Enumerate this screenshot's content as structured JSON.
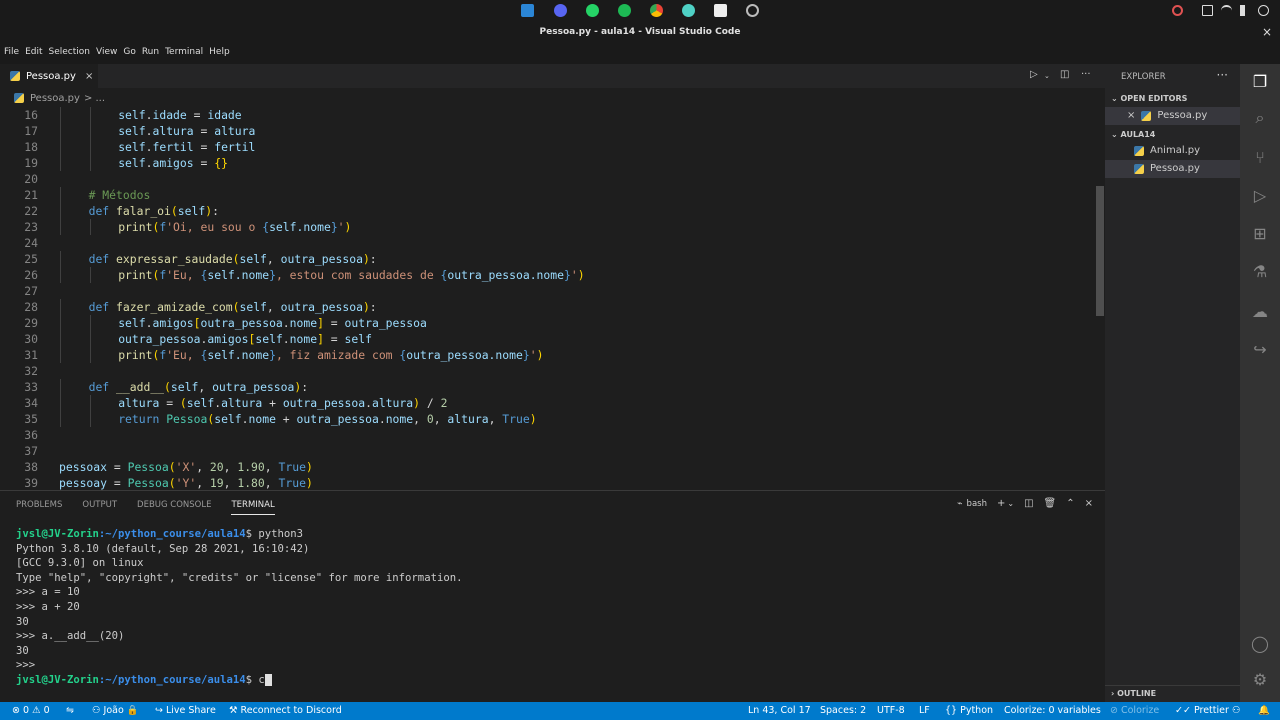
{
  "window": {
    "title": "Pessoa.py - aula14 - Visual Studio Code",
    "close": "×"
  },
  "menu": [
    "File",
    "Edit",
    "Selection",
    "View",
    "Go",
    "Run",
    "Terminal",
    "Help"
  ],
  "tab": {
    "label": "Pessoa.py",
    "close": "×"
  },
  "breadcrumb": {
    "file": "Pessoa.py",
    "more": "> ..."
  },
  "code_lines": [
    {
      "n": "16",
      "text": "self.idade = idade",
      "indent": 2
    },
    {
      "n": "17",
      "text": "self.altura = altura",
      "indent": 2
    },
    {
      "n": "18",
      "text": "self.fertil = fertil",
      "indent": 2
    },
    {
      "n": "19",
      "text": "self.amigos = {}",
      "indent": 2
    },
    {
      "n": "20",
      "text": "",
      "indent": 0
    },
    {
      "n": "21",
      "text": "# Métodos",
      "indent": 1,
      "kind": "comment"
    },
    {
      "n": "22",
      "text": "def falar_oi(self):",
      "indent": 1,
      "kind": "def"
    },
    {
      "n": "23",
      "text": "print(f'Oi, eu sou o {self.nome}')",
      "indent": 2
    },
    {
      "n": "24",
      "text": "",
      "indent": 0
    },
    {
      "n": "25",
      "text": "def expressar_saudade(self, outra_pessoa):",
      "indent": 1,
      "kind": "def"
    },
    {
      "n": "26",
      "text": "print(f'Eu, {self.nome}, estou com saudades de {outra_pessoa.nome}')",
      "indent": 2
    },
    {
      "n": "27",
      "text": "",
      "indent": 0
    },
    {
      "n": "28",
      "text": "def fazer_amizade_com(self, outra_pessoa):",
      "indent": 1,
      "kind": "def"
    },
    {
      "n": "29",
      "text": "self.amigos[outra_pessoa.nome] = outra_pessoa",
      "indent": 2
    },
    {
      "n": "30",
      "text": "outra_pessoa.amigos[self.nome] = self",
      "indent": 2
    },
    {
      "n": "31",
      "text": "print(f'Eu, {self.nome}, fiz amizade com {outra_pessoa.nome}')",
      "indent": 2
    },
    {
      "n": "32",
      "text": "",
      "indent": 0
    },
    {
      "n": "33",
      "text": "def __add__(self, outra_pessoa):",
      "indent": 1,
      "kind": "def"
    },
    {
      "n": "34",
      "text": "altura = (self.altura + outra_pessoa.altura) / 2",
      "indent": 2
    },
    {
      "n": "35",
      "text": "return Pessoa(self.nome + outra_pessoa.nome, 0, altura, True)",
      "indent": 2
    },
    {
      "n": "36",
      "text": "",
      "indent": 0
    },
    {
      "n": "37",
      "text": "",
      "indent": 0
    },
    {
      "n": "38",
      "text": "pessoax = Pessoa('X', 20, 1.90, True)",
      "indent": 0
    },
    {
      "n": "39",
      "text": "pessoay = Pessoa('Y', 19, 1.80, True)",
      "indent": 0
    }
  ],
  "panel": {
    "tabs": [
      "PROBLEMS",
      "OUTPUT",
      "DEBUG CONSOLE",
      "TERMINAL"
    ],
    "active_tab": "TERMINAL",
    "shell": "bash"
  },
  "terminal": {
    "prompt_user": "jvsl@JV-Zorin",
    "prompt_path": ":~/python_course/aula14",
    "first_command": "python3",
    "current_input": "c",
    "output_lines": [
      "Python 3.8.10 (default, Sep 28 2021, 16:10:42)",
      "[GCC 9.3.0] on linux",
      "Type \"help\", \"copyright\", \"credits\" or \"license\" for more information.",
      ">>> a = 10",
      ">>> a + 20",
      "30",
      ">>> a.__add__(20)",
      "30",
      ">>>"
    ]
  },
  "sidebar": {
    "title": "EXPLORER",
    "more": "···",
    "open_editors_label": "OPEN EDITORS",
    "open_editors": [
      "Pessoa.py"
    ],
    "folder_label": "AULA14",
    "files": [
      "Animal.py",
      "Pessoa.py"
    ],
    "selected_file": "Pessoa.py",
    "outline_label": "OUTLINE"
  },
  "status": {
    "errors": "0",
    "warnings": "0",
    "user": "João",
    "live_share": "Live Share",
    "discord": "Reconnect to Discord",
    "position": "Ln 43, Col 17",
    "spaces": "Spaces: 2",
    "encoding": "UTF-8",
    "eol": "LF",
    "language": "Python",
    "colorize_vars": "Colorize: 0 variables",
    "colorize": "Colorize",
    "prettier": "Prettier"
  },
  "colors": {
    "accent": "#007acc",
    "keyword": "#569cd6",
    "function": "#dcdcaa",
    "string": "#ce9178",
    "comment": "#6a9955",
    "prompt_user": "#23d18b",
    "prompt_path": "#3b8eea"
  }
}
